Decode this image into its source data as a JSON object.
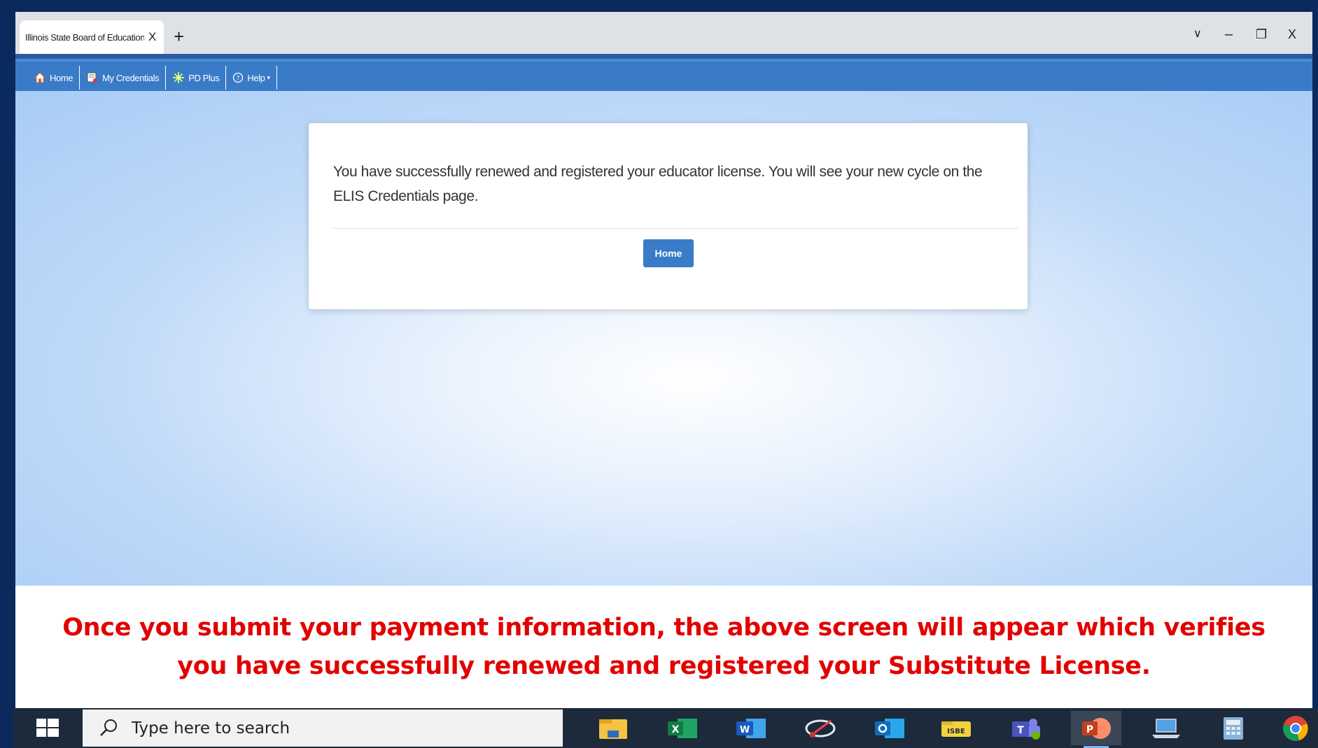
{
  "browser": {
    "tab_title": "Illinois State Board of Education",
    "tab_close": "X",
    "new_tab": "+",
    "controls": {
      "dropdown": "∨",
      "minimize": "–",
      "restore": "❐",
      "close": "X"
    }
  },
  "nav": {
    "items": [
      {
        "label": "Home",
        "icon": "house-icon"
      },
      {
        "label": "My Credentials",
        "icon": "certificate-icon"
      },
      {
        "label": "PD Plus",
        "icon": "sparkle-icon"
      },
      {
        "label": "Help",
        "icon": "help-circle-icon",
        "has_dropdown": true
      }
    ]
  },
  "card": {
    "message": "You have successfully renewed and registered your educator license. You will see your new cycle on the ELIS Credentials page.",
    "home_button": "Home"
  },
  "caption": {
    "text": "Once you submit your payment information, the above screen will appear which verifies you have successfully renewed and registered your Substitute License."
  },
  "taskbar": {
    "search_placeholder": "Type here to search",
    "apps": [
      "file-explorer-icon",
      "excel-icon",
      "word-icon",
      "snipping-tool-icon",
      "outlook-icon",
      "isbe-icon",
      "teams-icon",
      "powerpoint-icon",
      "laptop-icon",
      "calculator-icon",
      "chrome-icon"
    ],
    "active_app": "powerpoint-icon"
  },
  "colors": {
    "nav_blue": "#3a7bc8",
    "caption_red": "#e20000",
    "taskbar_bg": "#1c2a3b"
  }
}
